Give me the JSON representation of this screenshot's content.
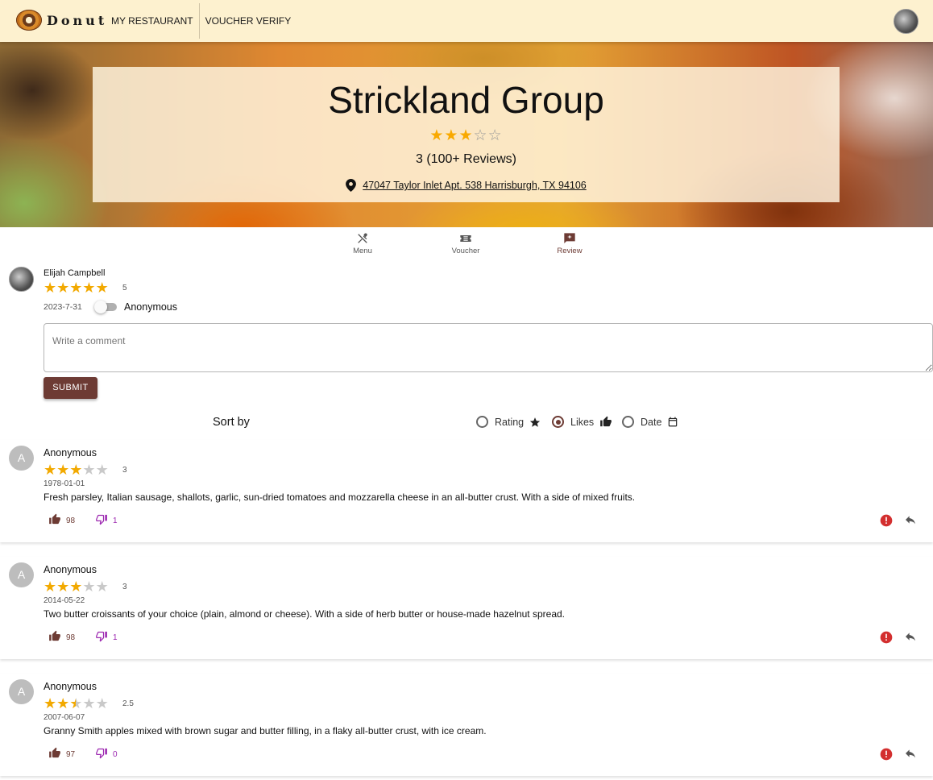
{
  "app": {
    "name": "Donut"
  },
  "nav": {
    "my_restaurant": "MY RESTAURANT",
    "voucher_verify": "VOUCHER VERIFY"
  },
  "restaurant": {
    "name": "Strickland Group",
    "rating": 3,
    "rating_text": "3 (100+ Reviews)",
    "address": "47047 Taylor Inlet Apt. 538 Harrisburgh, TX 94106"
  },
  "tabs": [
    {
      "label": "Menu",
      "icon": "fork-knife-icon",
      "active": false
    },
    {
      "label": "Voucher",
      "icon": "ticket-icon",
      "active": false
    },
    {
      "label": "Review",
      "icon": "review-icon",
      "active": true
    }
  ],
  "composer": {
    "user_name": "Elijah Campbell",
    "rating": 5,
    "rating_text": "5",
    "date": "2023-7-31",
    "anonymous_label": "Anonymous",
    "anonymous": false,
    "comment_placeholder": "Write a comment",
    "submit_label": "SUBMIT"
  },
  "sort": {
    "label": "Sort by",
    "options": [
      {
        "label": "Rating",
        "icon": "star-icon",
        "selected": false
      },
      {
        "label": "Likes",
        "icon": "thumb-up-icon",
        "selected": true
      },
      {
        "label": "Date",
        "icon": "calendar-icon",
        "selected": false
      }
    ]
  },
  "reviews": [
    {
      "avatar_letter": "A",
      "name": "Anonymous",
      "rating": 3,
      "rating_text": "3",
      "date": "1978-01-01",
      "text": "Fresh parsley, Italian sausage, shallots, garlic, sun-dried tomatoes and mozzarella cheese in an all-butter crust. With a side of mixed fruits.",
      "likes": "98",
      "dislikes": "1"
    },
    {
      "avatar_letter": "A",
      "name": "Anonymous",
      "rating": 3,
      "rating_text": "3",
      "date": "2014-05-22",
      "text": "Two butter croissants of your choice (plain, almond or cheese). With a side of herb butter or house-made hazelnut spread.",
      "likes": "98",
      "dislikes": "1"
    },
    {
      "avatar_letter": "A",
      "name": "Anonymous",
      "rating": 2.5,
      "rating_text": "2.5",
      "date": "2007-06-07",
      "text": "Granny Smith apples mixed with brown sugar and butter filling, in a flaky all-butter crust, with ice cream.",
      "likes": "97",
      "dislikes": "0"
    }
  ],
  "colors": {
    "brand": "#6d3b34",
    "star": "#f2a900",
    "topbar": "#fdf1cf",
    "report": "#d32f2f",
    "dislike": "#9c27b0"
  }
}
